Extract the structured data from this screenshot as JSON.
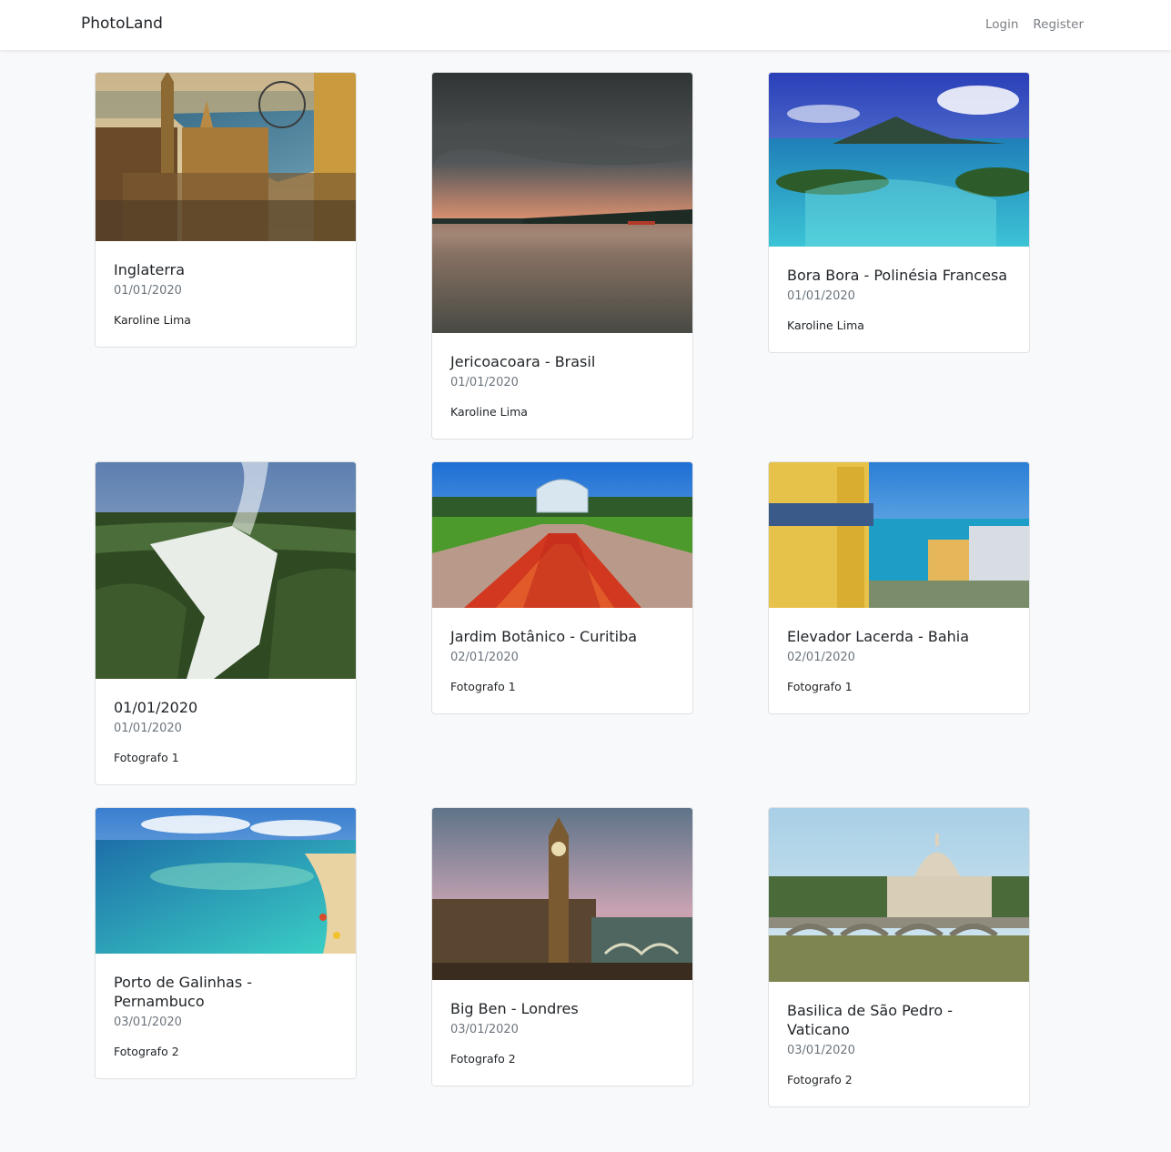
{
  "navbar": {
    "brand": "PhotoLand",
    "links": [
      {
        "label": "Login"
      },
      {
        "label": "Register"
      }
    ]
  },
  "cards": [
    {
      "title": "Inglaterra",
      "date": "01/01/2020",
      "author": "Karoline Lima",
      "image": "london-skyline"
    },
    {
      "title": "Jericoacoara - Brasil",
      "date": "01/01/2020",
      "author": "Karoline Lima",
      "image": "beach-sunset"
    },
    {
      "title": "Bora Bora - Polinésia Francesa",
      "date": "01/01/2020",
      "author": "Karoline Lima",
      "image": "tropical-lagoon"
    },
    {
      "title": "01/01/2020",
      "date": "01/01/2020",
      "author": "Fotografo 1",
      "image": "waterfalls"
    },
    {
      "title": "Jardim Botânico - Curitiba",
      "date": "02/01/2020",
      "author": "Fotografo 1",
      "image": "botanical-garden"
    },
    {
      "title": "Elevador Lacerda - Bahia",
      "date": "02/01/2020",
      "author": "Fotografo 1",
      "image": "elevator-bay"
    },
    {
      "title": "Porto de Galinhas - Pernambuco",
      "date": "03/01/2020",
      "author": "Fotografo 2",
      "image": "reef-beach"
    },
    {
      "title": "Big Ben - Londres",
      "date": "03/01/2020",
      "author": "Fotografo 2",
      "image": "big-ben"
    },
    {
      "title": "Basilica de São Pedro - Vaticano",
      "date": "03/01/2020",
      "author": "Fotografo 2",
      "image": "st-peters-basilica"
    }
  ]
}
